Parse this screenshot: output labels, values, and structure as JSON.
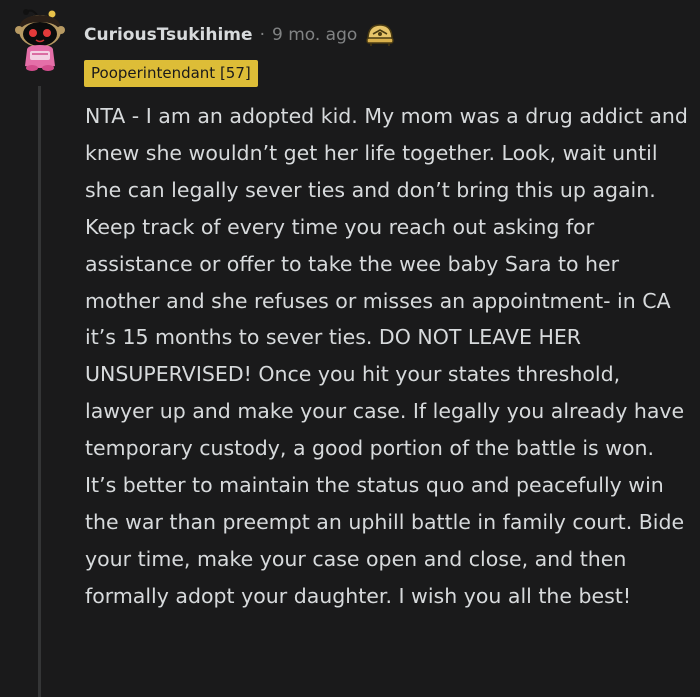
{
  "comment": {
    "author": "CuriousTsukihime",
    "separator": "·",
    "timestamp": "9 mo. ago",
    "award_icon": "helmet-award-icon",
    "flair": "Pooperintendant [57]",
    "body": "NTA - I am an adopted kid. My mom was a drug addict and knew she wouldn’t get her life together. Look, wait until she can legally sever ties and don’t bring this up again. Keep track of every time you reach out asking for assistance or offer to take the wee baby Sara to her mother and she refuses or misses an appointment- in CA it’s 15 months to sever ties. DO NOT LEAVE HER UNSUPERVISED! Once you hit your states threshold, lawyer up and make your case. If legally you already have temporary custody, a good portion of the battle is won. It’s better to maintain the status quo and peacefully win the war than preempt an uphill battle in family court. Bide your time, make your case open and close, and then formally adopt your daughter. I wish you all the best!"
  },
  "colors": {
    "background": "#1a1a1b",
    "text": "#d7dadc",
    "muted": "#818384",
    "flair_bg": "#ddbd37",
    "thread_line": "#343536"
  }
}
